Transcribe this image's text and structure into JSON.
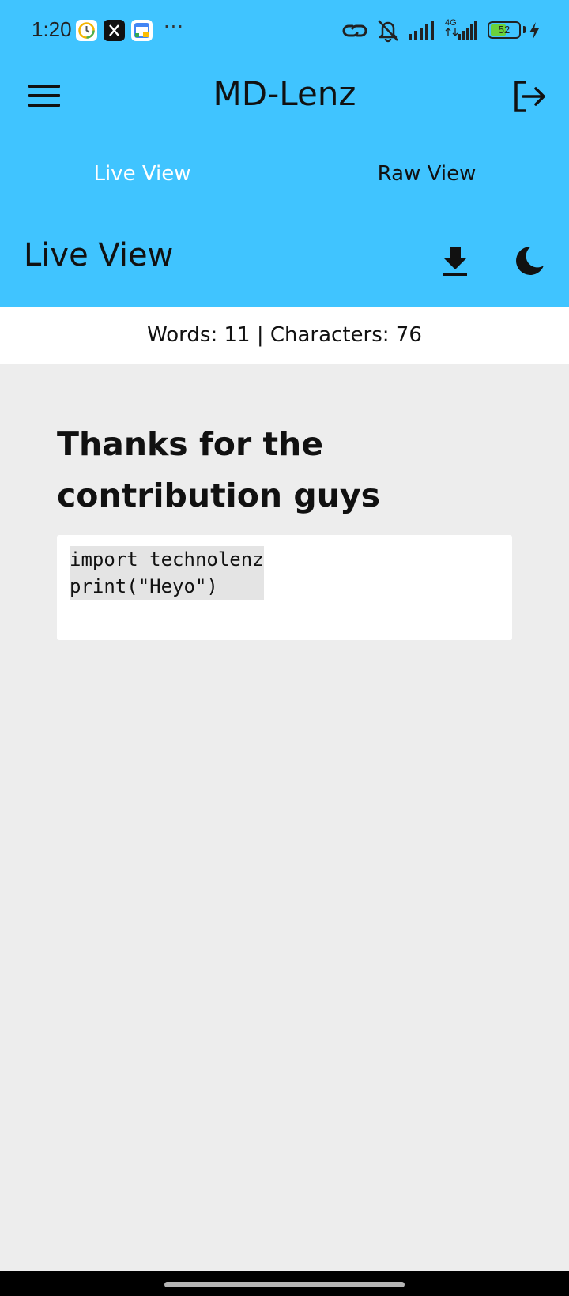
{
  "status_bar": {
    "time": "1:20",
    "more": "···",
    "battery": "52",
    "network": "4G"
  },
  "app": {
    "title": "MD-Lenz",
    "accent_color": "#40c4ff"
  },
  "tabs": [
    {
      "label": "Live View",
      "active": true
    },
    {
      "label": "Raw View",
      "active": false
    }
  ],
  "section": {
    "title": "Live View"
  },
  "stats": {
    "text": "Words: 11 | Characters: 76"
  },
  "content": {
    "heading": "Thanks for the contribution guys",
    "code_lines": [
      "import technolenz",
      "print(\"Heyo\")"
    ]
  },
  "icons": [
    "menu-icon",
    "logout-icon",
    "download-icon",
    "dark-mode-icon",
    "link-icon",
    "mute-icon",
    "signal-icon",
    "battery-icon",
    "charging-icon"
  ]
}
